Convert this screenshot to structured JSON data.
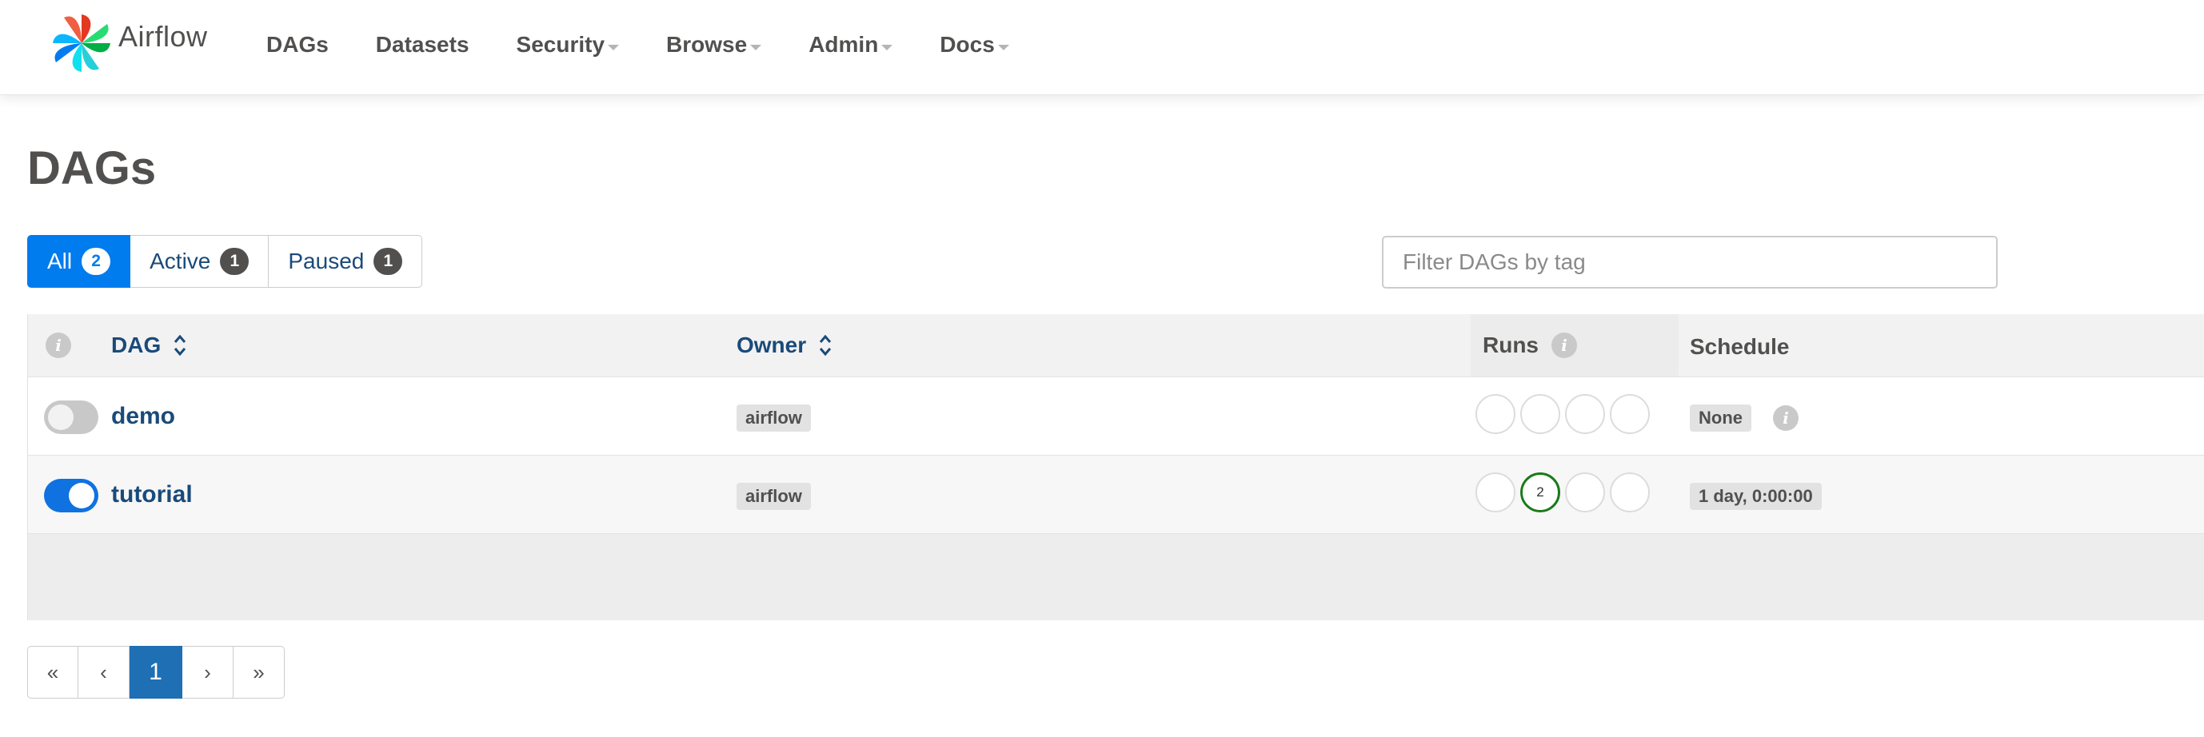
{
  "app": {
    "brand_name": "Airflow",
    "colors": {
      "primary": "#017cee",
      "link": "#1a4a7a",
      "text": "#51504f",
      "success": "#1a7a1a",
      "toggle_on": "#0f72e0",
      "toggle_off": "#c8c8c8",
      "pagination_active": "#1f6fb4"
    }
  },
  "nav": {
    "items": [
      {
        "label": "DAGs",
        "dropdown": false
      },
      {
        "label": "Datasets",
        "dropdown": false
      },
      {
        "label": "Security",
        "dropdown": true
      },
      {
        "label": "Browse",
        "dropdown": true
      },
      {
        "label": "Admin",
        "dropdown": true
      },
      {
        "label": "Docs",
        "dropdown": true
      }
    ]
  },
  "page": {
    "title": "DAGs"
  },
  "filters": {
    "all": {
      "label": "All",
      "count": "2",
      "active": true
    },
    "active": {
      "label": "Active",
      "count": "1",
      "active": false
    },
    "paused": {
      "label": "Paused",
      "count": "1",
      "active": false
    },
    "tag_placeholder": "Filter DAGs by tag"
  },
  "table": {
    "headers": {
      "info_icon": "info-icon",
      "dag": "DAG",
      "owner": "Owner",
      "runs": "Runs",
      "schedule": "Schedule"
    },
    "rows": [
      {
        "dag_id": "demo",
        "paused": true,
        "owner": "airflow",
        "runs": [
          "",
          "",
          "",
          ""
        ],
        "schedule": "None",
        "schedule_info_icon": "info-icon"
      },
      {
        "dag_id": "tutorial",
        "paused": false,
        "owner": "airflow",
        "runs": [
          "",
          "2",
          "",
          ""
        ],
        "run_states": [
          "none",
          "success",
          "none",
          "none"
        ],
        "schedule": "1 day, 0:00:00"
      }
    ]
  },
  "pagination": {
    "first": "«",
    "prev": "‹",
    "current": "1",
    "next": "›",
    "last": "»"
  }
}
